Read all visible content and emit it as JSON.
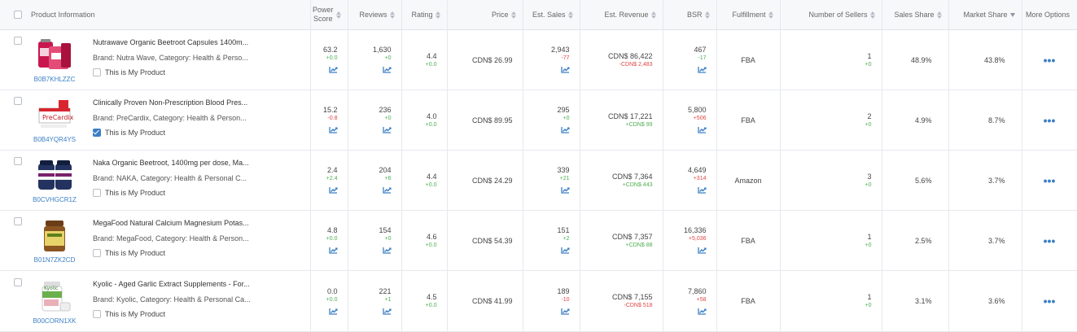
{
  "header": {
    "product_information": "Product Information",
    "power_score": "Power Score",
    "reviews": "Reviews",
    "rating": "Rating",
    "price": "Price",
    "est_sales": "Est. Sales",
    "est_revenue": "Est. Revenue",
    "bsr": "BSR",
    "fulfillment": "Fulfillment",
    "num_sellers": "Number of Sellers",
    "sales_share": "Sales Share",
    "market_share": "Market Share",
    "more_options": "More Options"
  },
  "my_product_label": "This is My Product",
  "more_glyph": "•••",
  "rows": [
    {
      "title": "Nutrawave Organic Beetroot Capsules 1400m...",
      "meta": "Brand: Nutra Wave,  Category: Health & Perso...",
      "asin": "B0B7KHLZZC",
      "is_mine": false,
      "power_score": "63.2",
      "power_score_delta": "+0.0",
      "reviews": "1,630",
      "reviews_delta": "+0",
      "rating": "4.4",
      "rating_delta": "+0.0",
      "price": "CDN$ 26.99",
      "est_sales": "2,943",
      "est_sales_delta": "-77",
      "est_revenue": "CDN$ 86,422",
      "est_revenue_delta": "-CDN$ 2,483",
      "bsr": "467",
      "bsr_delta": "-17",
      "fulfillment": "FBA",
      "sellers": "1",
      "sellers_delta": "+0",
      "sales_share": "48.9%",
      "market_share": "43.8%"
    },
    {
      "title": "Clinically Proven Non-Prescription Blood Pres...",
      "meta": "Brand: PreCardix,  Category: Health & Person...",
      "asin": "B0B4YQR4YS",
      "is_mine": true,
      "power_score": "15.2",
      "power_score_delta": "-0.8",
      "reviews": "236",
      "reviews_delta": "+0",
      "rating": "4.0",
      "rating_delta": "+0.0",
      "price": "CDN$ 89.95",
      "est_sales": "295",
      "est_sales_delta": "+0",
      "est_revenue": "CDN$ 17,221",
      "est_revenue_delta": "+CDN$ 99",
      "bsr": "5,800",
      "bsr_delta": "+506",
      "fulfillment": "FBA",
      "sellers": "2",
      "sellers_delta": "+0",
      "sales_share": "4.9%",
      "market_share": "8.7%"
    },
    {
      "title": "Naka Organic Beetroot, 1400mg per dose, Ma...",
      "meta": "Brand: NAKA,  Category: Health & Personal C...",
      "asin": "B0CVHGCR1Z",
      "is_mine": false,
      "power_score": "2.4",
      "power_score_delta": "+2.4",
      "reviews": "204",
      "reviews_delta": "+6",
      "rating": "4.4",
      "rating_delta": "+0.0",
      "price": "CDN$ 24.29",
      "est_sales": "339",
      "est_sales_delta": "+21",
      "est_revenue": "CDN$ 7,364",
      "est_revenue_delta": "+CDN$ 443",
      "bsr": "4,649",
      "bsr_delta": "+314",
      "fulfillment": "Amazon",
      "sellers": "3",
      "sellers_delta": "+0",
      "sales_share": "5.6%",
      "market_share": "3.7%"
    },
    {
      "title": "MegaFood Natural Calcium Magnesium Potas...",
      "meta": "Brand: MegaFood,  Category: Health & Person...",
      "asin": "B01N7ZK2CD",
      "is_mine": false,
      "power_score": "4.8",
      "power_score_delta": "+0.0",
      "reviews": "154",
      "reviews_delta": "+0",
      "rating": "4.6",
      "rating_delta": "+0.0",
      "price": "CDN$ 54.39",
      "est_sales": "151",
      "est_sales_delta": "+2",
      "est_revenue": "CDN$ 7,357",
      "est_revenue_delta": "+CDN$ 88",
      "bsr": "16,336",
      "bsr_delta": "+5,036",
      "fulfillment": "FBA",
      "sellers": "1",
      "sellers_delta": "+0",
      "sales_share": "2.5%",
      "market_share": "3.7%"
    },
    {
      "title": "Kyolic - Aged Garlic Extract Supplements - For...",
      "meta": "Brand: Kyolic,  Category: Health & Personal Ca...",
      "asin": "B00CORN1XK",
      "is_mine": false,
      "power_score": "0.0",
      "power_score_delta": "+0.0",
      "reviews": "221",
      "reviews_delta": "+1",
      "rating": "4.5",
      "rating_delta": "+0.0",
      "price": "CDN$ 41.99",
      "est_sales": "189",
      "est_sales_delta": "-10",
      "est_revenue": "CDN$ 7,155",
      "est_revenue_delta": "-CDN$ 518",
      "bsr": "7,860",
      "bsr_delta": "+58",
      "fulfillment": "FBA",
      "sellers": "1",
      "sellers_delta": "+0",
      "sales_share": "3.1%",
      "market_share": "3.6%"
    }
  ],
  "colors": {
    "accent": "#3b7fc4",
    "positive": "#4caf50",
    "negative": "#e04646",
    "header_bg": "#f6f8fa"
  }
}
